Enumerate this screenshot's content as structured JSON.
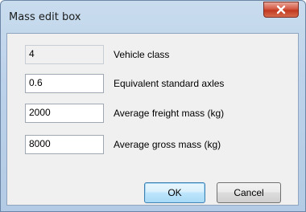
{
  "window": {
    "title": "Mass edit box"
  },
  "fields": [
    {
      "value": "4",
      "label": "Vehicle class"
    },
    {
      "value": "0.6",
      "label": "Equivalent standard axles"
    },
    {
      "value": "2000",
      "label": "Average freight mass (kg)"
    },
    {
      "value": "8000",
      "label": "Average gross mass (kg)"
    }
  ],
  "buttons": {
    "ok": "OK",
    "cancel": "Cancel"
  },
  "icons": {
    "close": "close-icon"
  }
}
